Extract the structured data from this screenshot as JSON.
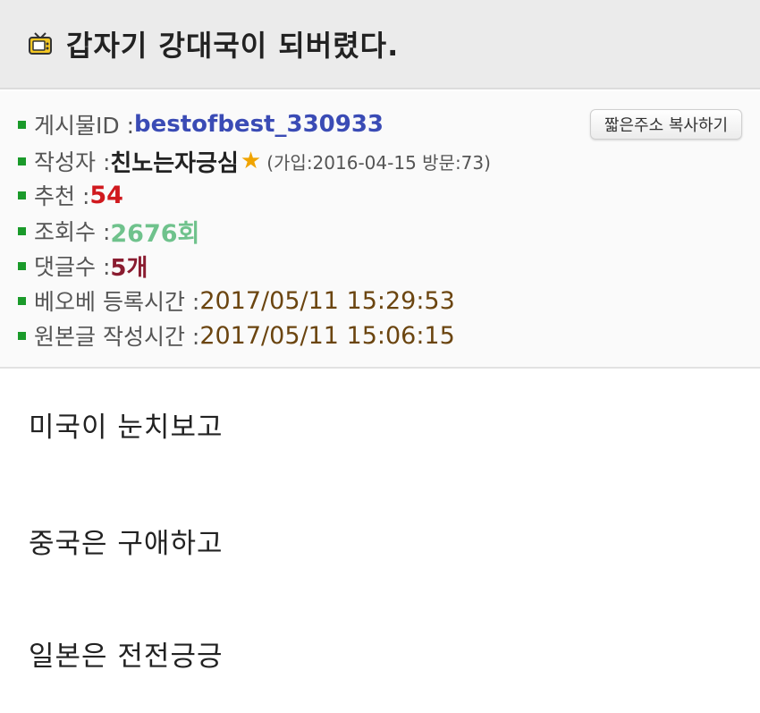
{
  "post": {
    "title": "갑자기 강대국이 되버렸다."
  },
  "info": {
    "post_id_label": "게시물ID : ",
    "post_id": "bestofbest_330933",
    "author_label": "작성자 : ",
    "author": "친노는자긍심",
    "author_star": "★",
    "author_meta": "(가입:2016-04-15 방문:73)",
    "recommend_label": "추천 : ",
    "recommend": "54",
    "views_label": "조회수 : ",
    "views": "2676회",
    "comments_label": "댓글수 : ",
    "comments": "5개",
    "bob_time_label": "베오베 등록시간 : ",
    "bob_time": "2017/05/11 15:29:53",
    "orig_time_label": "원본글 작성시간 : ",
    "orig_time": "2017/05/11 15:06:15"
  },
  "actions": {
    "copy_short_url": "짧은주소 복사하기"
  },
  "content": {
    "lines": [
      "미국이 눈치보고",
      "중국은 구애하고",
      "일본은 전전긍긍"
    ]
  },
  "colors": {
    "bullet": "#1a9a2a",
    "post_id": "#3a4bb5",
    "recommend": "#d0191e",
    "views": "#6fc28c",
    "comments": "#8a1c30",
    "time": "#6b4510",
    "star": "#f0a400"
  },
  "icons": {
    "title_icon": "tv-icon",
    "bullet_icon": "square-bullet-icon"
  }
}
